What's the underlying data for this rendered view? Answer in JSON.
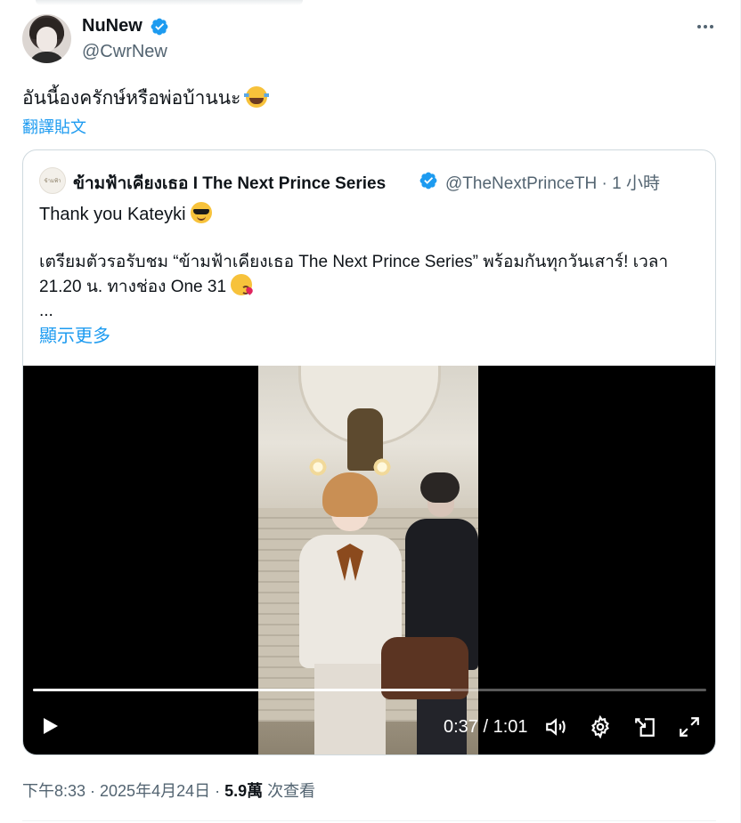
{
  "author": {
    "display_name": "NuNew",
    "handle": "@CwrNew",
    "verified": true
  },
  "tweet": {
    "text": "อันนี้องครักษ์หรือพ่อบ้านนะ",
    "emoji": "face-with-tears-of-joy-icon",
    "translate_label": "翻譯貼文"
  },
  "quote": {
    "avatar_text": "ข้ามฟ้า",
    "name": "ข้ามฟ้าเคียงเธอ I The Next Prince Series",
    "verified": true,
    "meta": "@TheNextPrinceTH · 1 小時",
    "line1": "Thank you Kateyki",
    "body_line1": "เตรียมตัวรอรับชม “ข้ามฟ้าเคียงเธอ The Next Prince Series” พร้อมกันทุกวันเสาร์! เวลา",
    "body_line2": "21.20 น. ทางช่อง One 31",
    "ellipsis": "...",
    "show_more": "顯示更多"
  },
  "video": {
    "time": "0:37 / 1:01",
    "progress": 0.62
  },
  "footer": {
    "posted": "下午8:33 · 2025年4月24日 · ",
    "views": "5.9萬",
    "views_suffix": " 次查看"
  },
  "colors": {
    "accent": "#1d9bf0",
    "text": "#0f1419",
    "muted": "#536471",
    "border": "#cfd9de"
  }
}
